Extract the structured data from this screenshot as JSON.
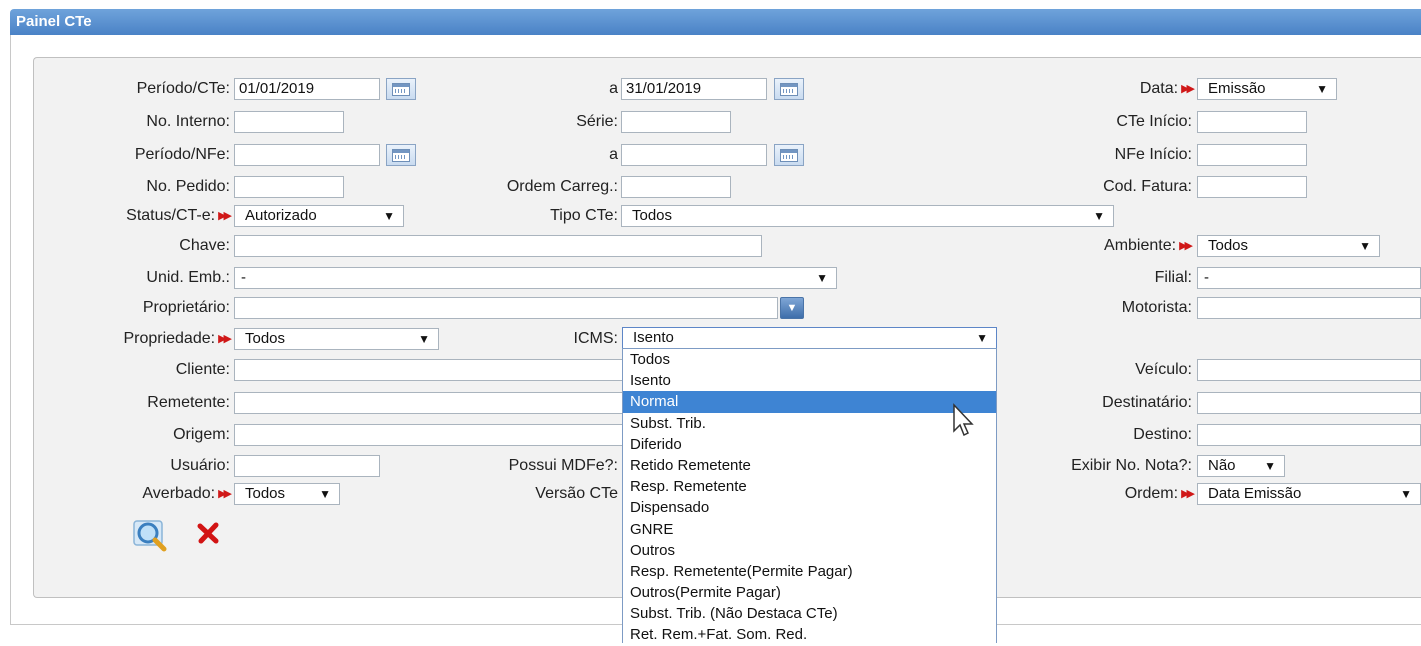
{
  "window": {
    "title": "Painel CTe"
  },
  "form": {
    "periodo_cte": {
      "label": "Período/CTe:",
      "value": "01/01/2019"
    },
    "periodo_cte_ate": {
      "label": "a",
      "value": "31/01/2019"
    },
    "data": {
      "label": "Data:",
      "value": "Emissão"
    },
    "no_interno": {
      "label": "No. Interno:",
      "value": ""
    },
    "serie": {
      "label": "Série:",
      "value": ""
    },
    "cte_inicio": {
      "label": "CTe Início:",
      "value": ""
    },
    "periodo_nfe": {
      "label": "Período/NFe:",
      "value": ""
    },
    "periodo_nfe_ate": {
      "label": "a",
      "value": ""
    },
    "nfe_inicio": {
      "label": "NFe Início:",
      "value": ""
    },
    "no_pedido": {
      "label": "No. Pedido:",
      "value": ""
    },
    "ordem_carreg": {
      "label": "Ordem Carreg.:",
      "value": ""
    },
    "cod_fatura": {
      "label": "Cod. Fatura:",
      "value": ""
    },
    "status_cte": {
      "label": "Status/CT-e:",
      "value": "Autorizado"
    },
    "tipo_cte": {
      "label": "Tipo CTe:",
      "value": "Todos"
    },
    "chave": {
      "label": "Chave:",
      "value": ""
    },
    "ambiente": {
      "label": "Ambiente:",
      "value": "Todos"
    },
    "unid_emb": {
      "label": "Unid. Emb.:",
      "value": "-"
    },
    "filial": {
      "label": "Filial:",
      "value": "-"
    },
    "proprietario": {
      "label": "Proprietário:",
      "value": ""
    },
    "motorista": {
      "label": "Motorista:",
      "value": ""
    },
    "propriedade": {
      "label": "Propriedade:",
      "value": "Todos"
    },
    "icms": {
      "label": "ICMS:",
      "value": "Isento"
    },
    "cliente": {
      "label": "Cliente:",
      "value": ""
    },
    "veiculo": {
      "label": "Veículo:",
      "value": ""
    },
    "remetente": {
      "label": "Remetente:",
      "value": ""
    },
    "destinatario": {
      "label": "Destinatário:",
      "value": ""
    },
    "origem": {
      "label": "Origem:",
      "value": ""
    },
    "destino": {
      "label": "Destino:",
      "value": ""
    },
    "usuario": {
      "label": "Usuário:",
      "value": ""
    },
    "possui_mdfe": {
      "label": "Possui MDFe?:"
    },
    "exibir_no_nota": {
      "label": "Exibir No. Nota?:",
      "value": "Não"
    },
    "averbado": {
      "label": "Averbado:",
      "value": "Todos"
    },
    "versao_cte": {
      "label": "Versão CTe"
    },
    "ordem": {
      "label": "Ordem:",
      "value": "Data Emissão"
    }
  },
  "icms_dropdown": {
    "highlighted": "Normal",
    "options": [
      "Todos",
      "Isento",
      "Normal",
      "Subst. Trib.",
      "Diferido",
      "Retido Remetente",
      "Resp. Remetente",
      "Dispensado",
      "GNRE",
      "Outros",
      "Resp. Remetente(Permite Pagar)",
      "Outros(Permite Pagar)",
      "Subst. Trib. (Não Destaca CTe)",
      "Ret. Rem.+Fat. Som. Red."
    ]
  },
  "icons": {
    "calendar": "calendar-icon",
    "search": "magnifier-icon",
    "clear": "red-x-icon",
    "required": "double-red-arrow-icon",
    "lookup": "combo-down-icon"
  },
  "colors": {
    "titlebar": "#4a82c6",
    "highlight": "#3e84d3",
    "required": "#d01818"
  }
}
